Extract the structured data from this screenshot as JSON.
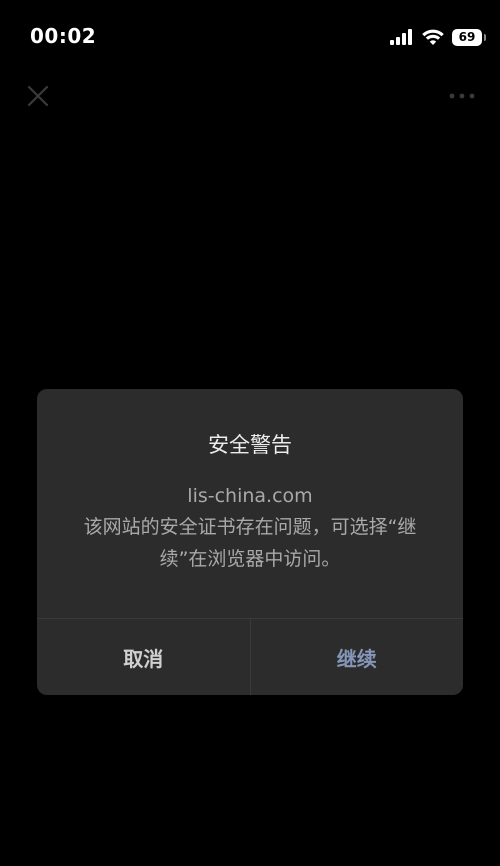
{
  "status_bar": {
    "time": "00:02",
    "battery": "69",
    "icons": [
      "signal-icon",
      "wifi-icon",
      "battery-icon"
    ]
  },
  "nav": {
    "close_icon": "close-icon",
    "more_icon": "more-icon"
  },
  "dialog": {
    "title": "安全警告",
    "domain": "lis-china.com",
    "message": "该网站的安全证书存在问题，可选择“继续”在浏览器中访问。",
    "cancel_label": "取消",
    "continue_label": "继续"
  },
  "colors": {
    "background": "#000000",
    "dialog_bg": "#2c2c2c",
    "continue_accent": "#8596b8"
  }
}
